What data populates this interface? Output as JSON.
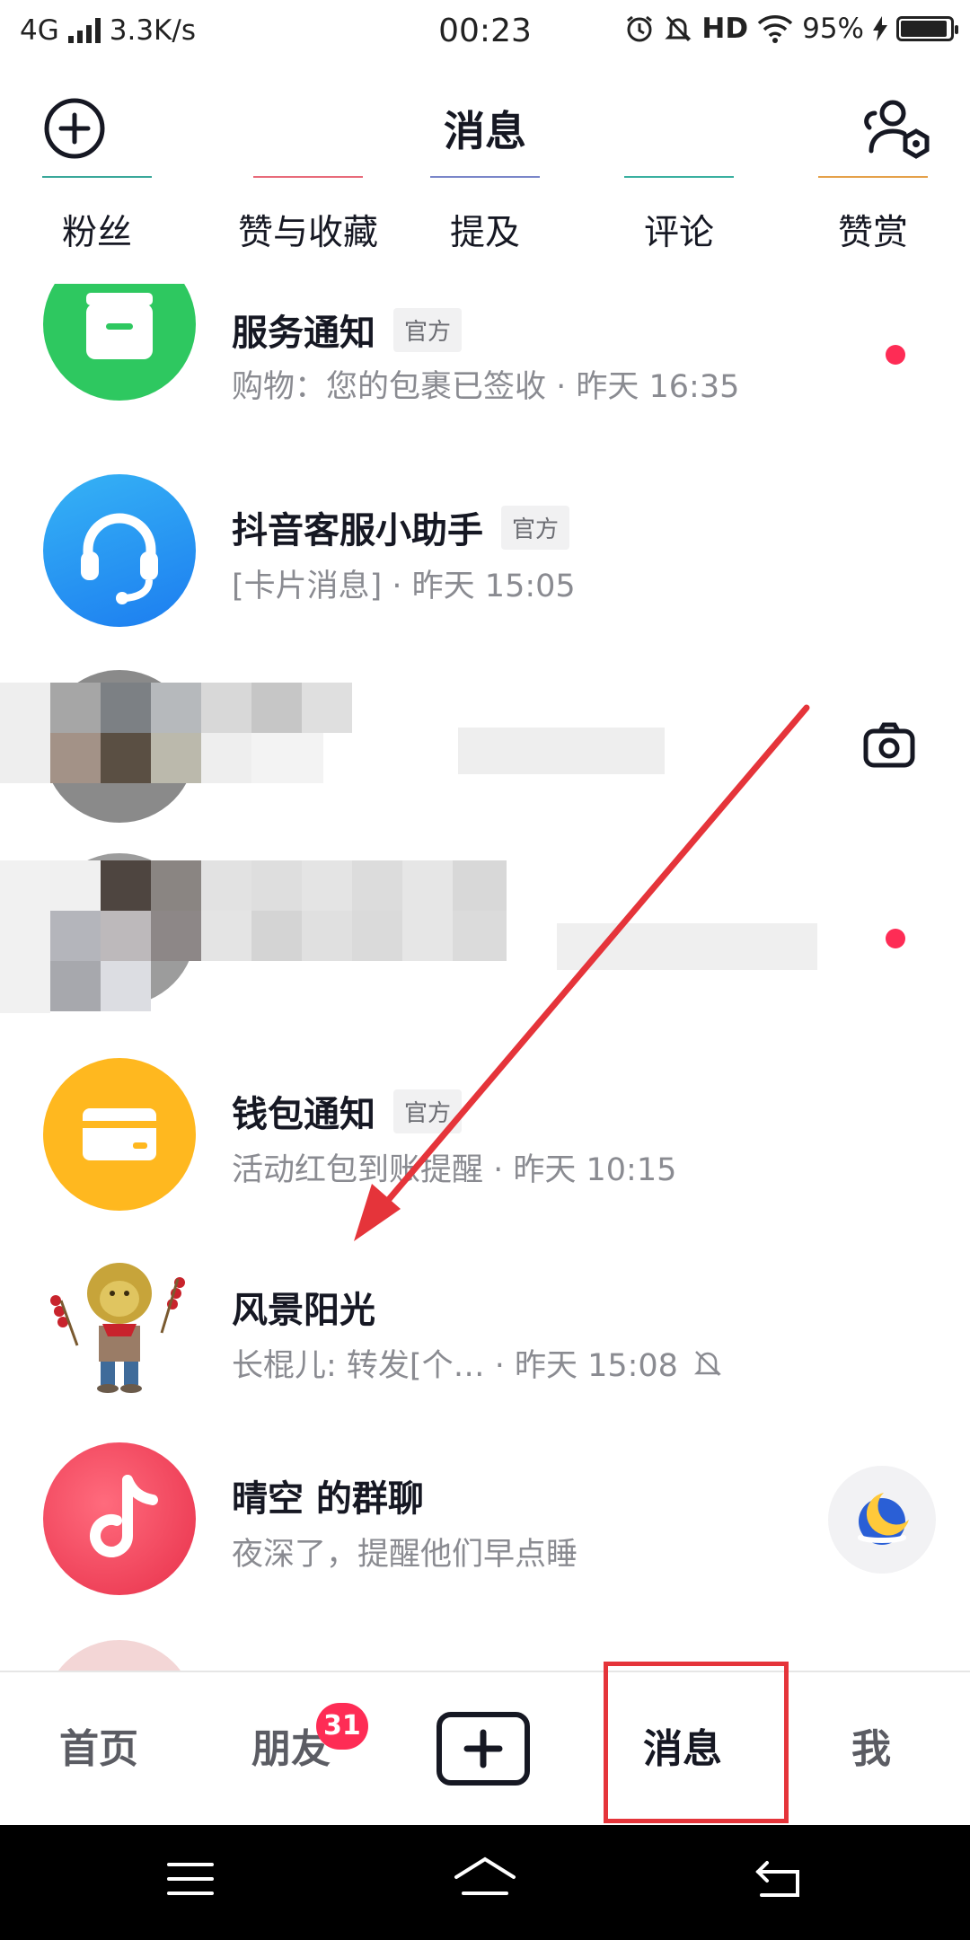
{
  "status_bar": {
    "network": "4G",
    "speed": "3.3K/s",
    "time": "00:23",
    "hd": "HD",
    "battery": "95%"
  },
  "header": {
    "title": "消息",
    "add_icon": "plus-circle-icon",
    "contacts_icon": "contacts-settings-icon"
  },
  "tabs": [
    {
      "label": "粉丝",
      "color": "#3aa89a"
    },
    {
      "label": "赞与收藏",
      "color": "#e86b7a"
    },
    {
      "label": "提及",
      "color": "#7a86c9"
    },
    {
      "label": "评论",
      "color": "#3ab0a0"
    },
    {
      "label": "赞赏",
      "color": "#e5a14a"
    }
  ],
  "messages": [
    {
      "name": "服务通知",
      "badge": "官方",
      "preview": "购物：您的包裹已签收 · 昨天 16:35",
      "unread": true
    },
    {
      "name": "抖音客服小助手",
      "badge": "官方",
      "preview": "[卡片消息] · 昨天 15:05",
      "unread": false
    },
    {
      "name": "",
      "preview": "",
      "unread": false,
      "action_icon": "camera-icon"
    },
    {
      "name": "",
      "preview": "",
      "unread": true
    },
    {
      "name": "钱包通知",
      "badge": "官方",
      "preview": "活动红包到账提醒 · 昨天 10:15",
      "unread": false
    },
    {
      "name": "风景阳光",
      "preview": "长棍儿: 转发[个…  · 昨天 15:08",
      "unread": false,
      "muted_icon": "bell-off-icon"
    },
    {
      "name": "晴空 的群聊",
      "preview": "夜深了，提醒他们早点睡",
      "unread": false,
      "action_icon": "moon-icon"
    }
  ],
  "tabbar": {
    "home": "首页",
    "friends": "朋友",
    "friends_badge": "31",
    "create_icon": "plus-square-icon",
    "messages": "消息",
    "me": "我"
  },
  "colors": {
    "accent": "#fe2c55",
    "highlight": "#e5343a",
    "service_green": "#2ec860",
    "support_blue": "#2a8cf0",
    "wallet_yellow": "#ffb81f"
  }
}
